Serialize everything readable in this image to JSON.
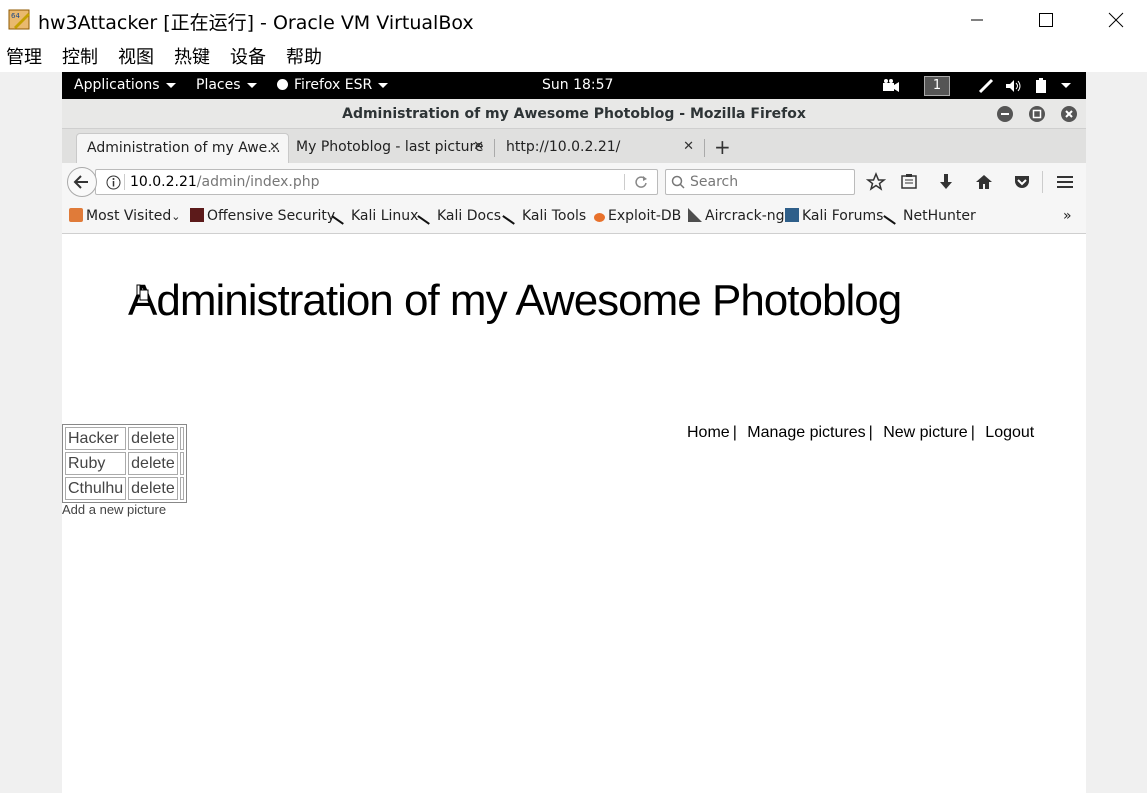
{
  "host": {
    "title": "hw3Attacker [正在运行] - Oracle VM VirtualBox",
    "menu": [
      "管理",
      "控制",
      "视图",
      "热键",
      "设备",
      "帮助"
    ]
  },
  "gnome": {
    "applications": "Applications",
    "places": "Places",
    "firefox": "Firefox ESR",
    "clock": "Sun 18:57",
    "workspace": "1"
  },
  "firefox": {
    "window_title": "Administration of my Awesome Photoblog - Mozilla Firefox",
    "tabs": [
      {
        "label": "Administration of my Awe..."
      },
      {
        "label": "My Photoblog - last picture"
      },
      {
        "label": "http://10.0.2.21/"
      }
    ],
    "url_host": "10.0.2.21",
    "url_path": "/admin/index.php",
    "search_placeholder": "Search",
    "bookmarks": [
      "Most Visited",
      "Offensive Security",
      "Kali Linux",
      "Kali Docs",
      "Kali Tools",
      "Exploit-DB",
      "Aircrack-ng",
      "Kali Forums",
      "NetHunter"
    ],
    "overflow": "»"
  },
  "page": {
    "heading": "Administration of my Awesome Photoblog",
    "nav": {
      "home": "Home",
      "manage": "Manage pictures",
      "new": "New picture",
      "logout": "Logout",
      "sep": "|"
    },
    "pictures": [
      {
        "title": "Hacker",
        "action": "delete"
      },
      {
        "title": "Ruby",
        "action": "delete"
      },
      {
        "title": "Cthulhu",
        "action": "delete"
      }
    ],
    "add_link": "Add a new picture"
  },
  "colors": {
    "gnome_bar": "#000000",
    "ff_chrome": "#f6f6f6"
  }
}
